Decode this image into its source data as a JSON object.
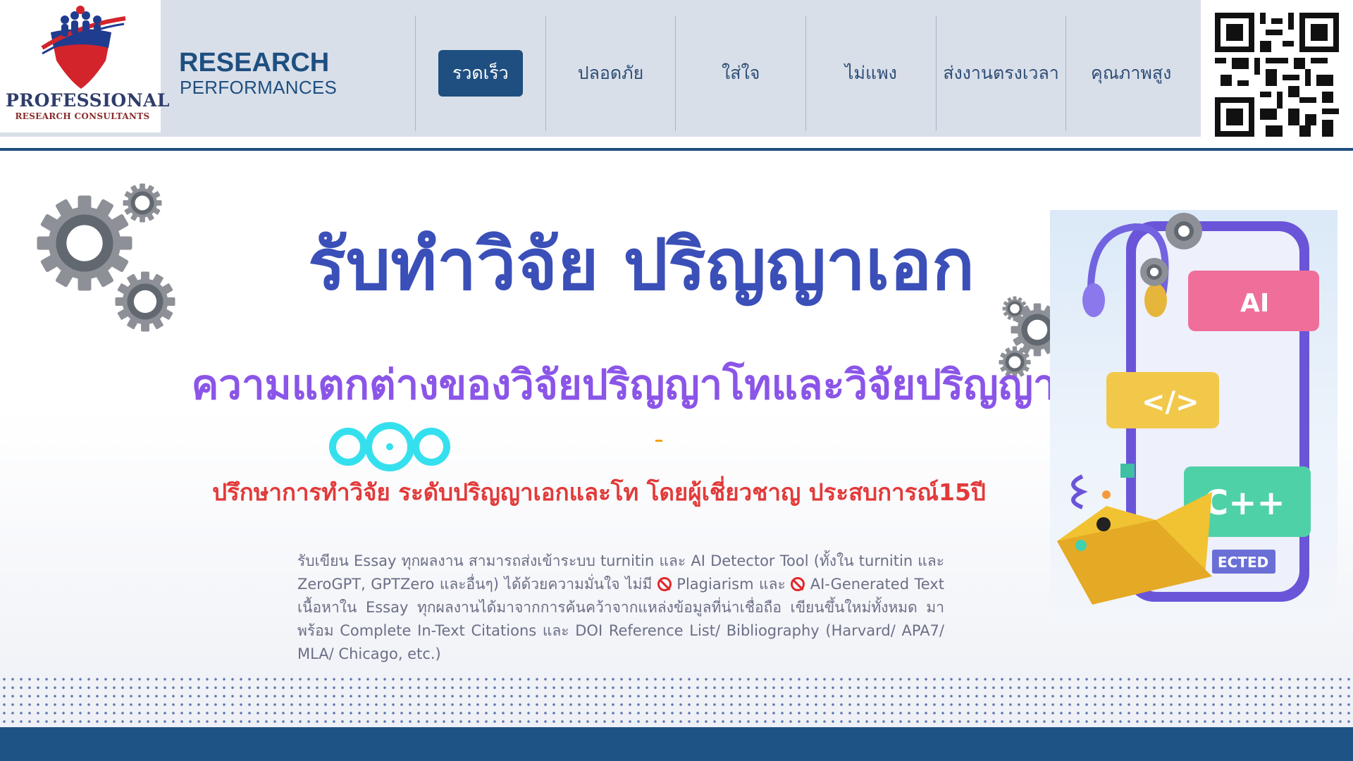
{
  "logo": {
    "line1": "PROFESSIONAL",
    "line2": "RESEARCH CONSULTANTS"
  },
  "brand": {
    "title": "RESEARCH",
    "subtitle": "PERFORMANCES"
  },
  "nav": {
    "items": [
      {
        "label": "รวดเร็ว",
        "active": true
      },
      {
        "label": "ปลอดภัย",
        "active": false
      },
      {
        "label": "ใส่ใจ",
        "active": false
      },
      {
        "label": "ไม่แพง",
        "active": false
      },
      {
        "label": "ส่งงานตรงเวลา",
        "active": false
      },
      {
        "label": "คุณภาพสูง",
        "active": false
      }
    ]
  },
  "hero": {
    "title": "รับทำวิจัย ปริญญาเอก",
    "subtitle": "ความแตกต่างของวิจัยปริญญาโทและวิจัยปริญญาเอก",
    "tagline": "ปรึกษาการทำวิจัย ระดับปริญญาเอกและโท โดยผู้เชี่ยวชาญ ประสบการณ์15ปี",
    "body": {
      "part1": "รับเขียน Essay ทุกผลงาน สามารถส่งเข้าระบบ turnitin และ AI Detector Tool (ทั้งใน turnitin และ ZeroGPT, GPTZero และอื่นๆ) ได้ด้วยความมั่นใจ ไม่มี",
      "part2": "Plagiarism และ",
      "part3": "AI-Generated Text เนื้อหาใน Essay ทุกผลงานได้มาจากการค้นคว้าจากแหล่งข้อมูลที่น่าเชื่อถือ เขียนขึ้นใหม่ทั้งหมด มาพร้อม Complete In-Text Citations และ DOI Reference List/ Bibliography (Harvard/ APA7/ MLA/ Chicago, etc.)"
    }
  },
  "illustration": {
    "labels": [
      "AI",
      "C++",
      "ECTED"
    ]
  },
  "colors": {
    "header_bg": "#d9dfe9",
    "brand_blue": "#1e4f80",
    "title_blue": "#3b4fb8",
    "subtitle_purple": "#8b55e8",
    "tagline_red": "#e23a3a"
  }
}
